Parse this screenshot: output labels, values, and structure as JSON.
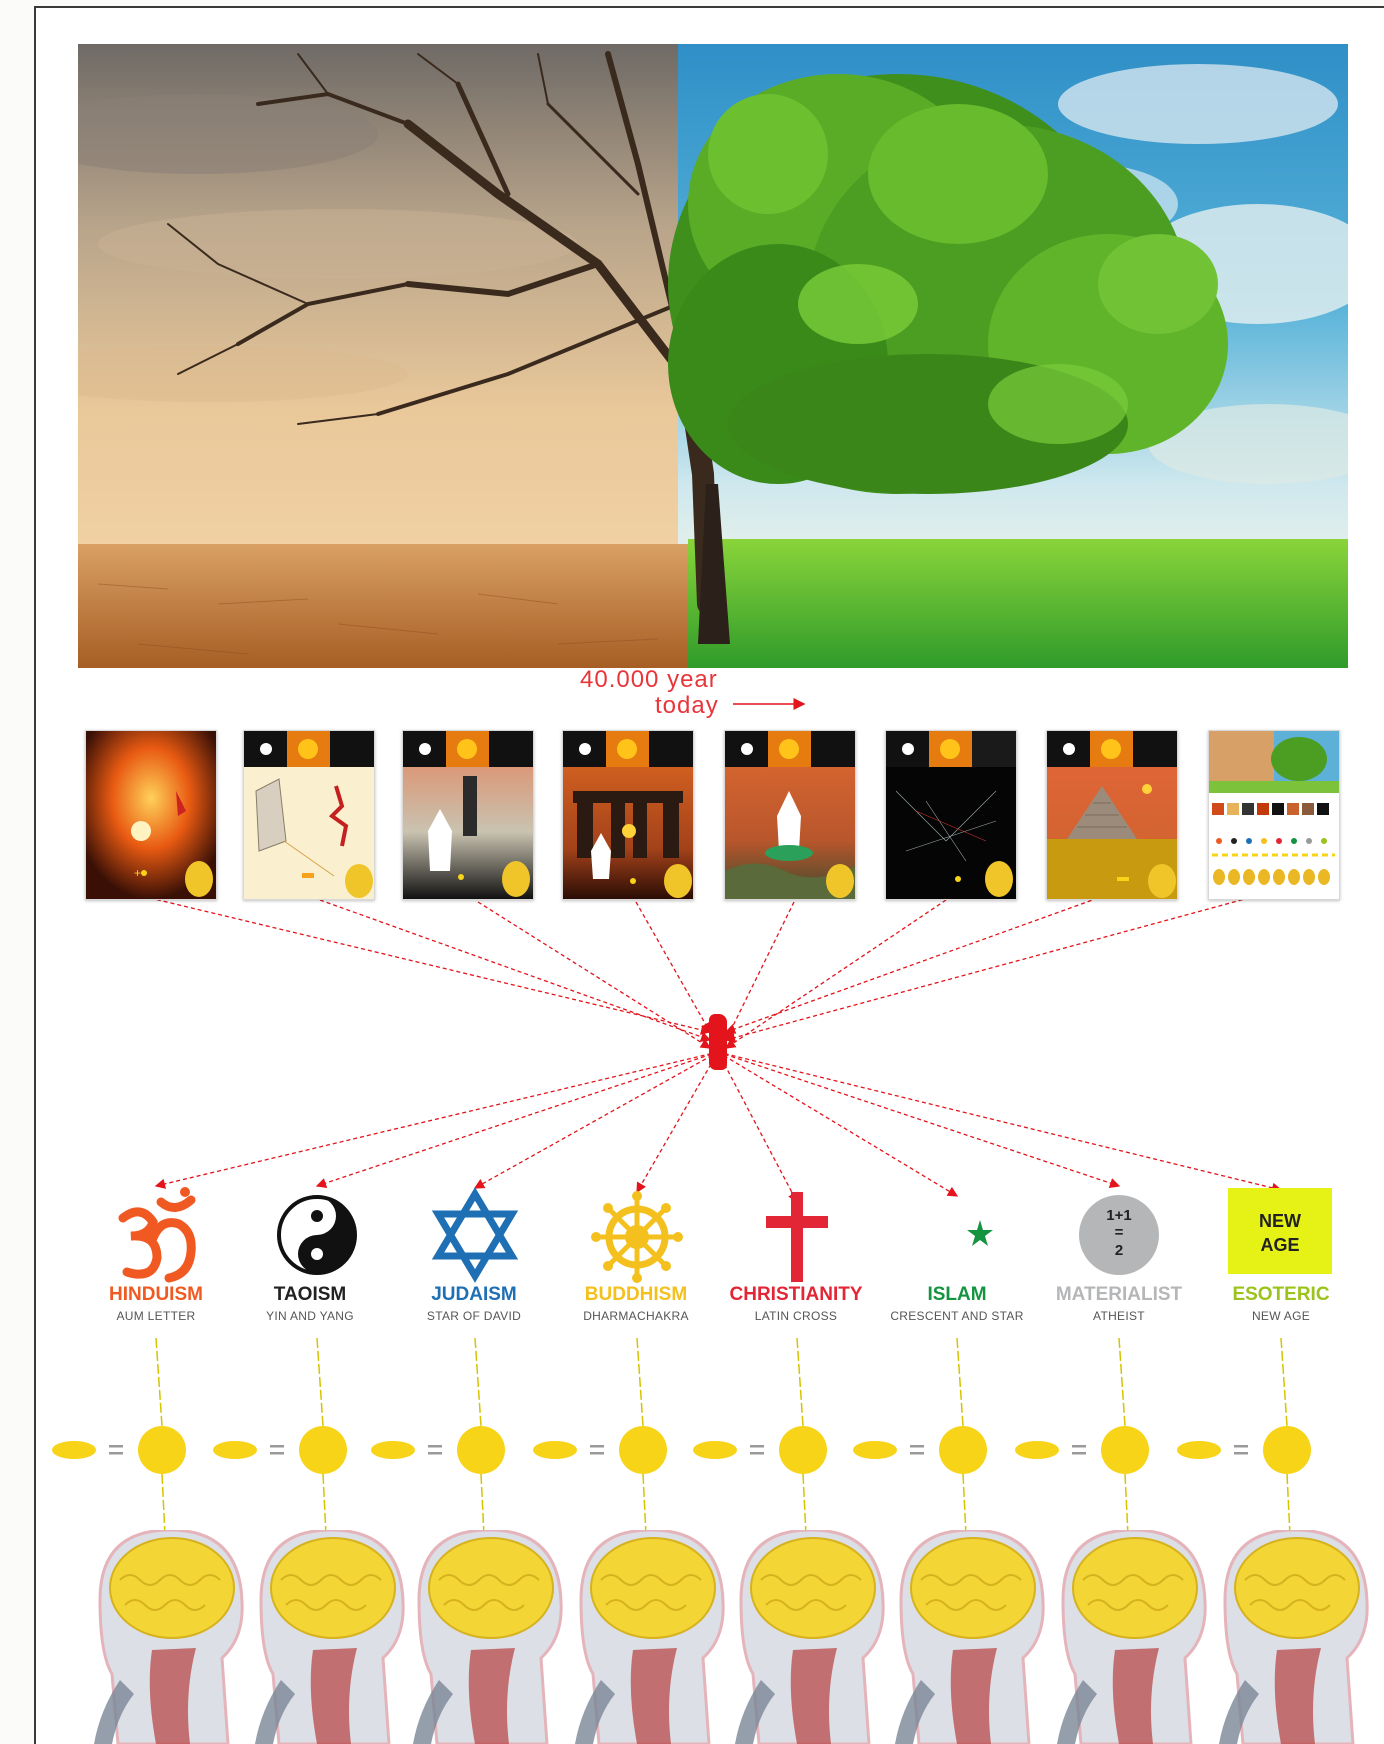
{
  "timeline": {
    "start_label": "40.000 year",
    "end_label": "today"
  },
  "thumbnails": [
    {
      "name": "thumb-cave-fire"
    },
    {
      "name": "thumb-cave-painting"
    },
    {
      "name": "thumb-shaman"
    },
    {
      "name": "thumb-stonehenge"
    },
    {
      "name": "thumb-prophet-water"
    },
    {
      "name": "thumb-dark-lines"
    },
    {
      "name": "thumb-pyramid"
    },
    {
      "name": "thumb-summary"
    }
  ],
  "religions": [
    {
      "name": "HINDUISM",
      "symbol_name": "AUM LETTER",
      "color": "#f05a22",
      "icon": "aum-icon"
    },
    {
      "name": "TAOISM",
      "symbol_name": "YIN AND YANG",
      "color": "#222222",
      "icon": "yin-yang-icon"
    },
    {
      "name": "JUDAISM",
      "symbol_name": "STAR OF DAVID",
      "color": "#1f6fb4",
      "icon": "star-of-david-icon"
    },
    {
      "name": "BUDDHISM",
      "symbol_name": "DHARMACHAKRA",
      "color": "#f4c01e",
      "icon": "dharmachakra-icon"
    },
    {
      "name": "CHRISTIANITY",
      "symbol_name": "LATIN CROSS",
      "color": "#e32636",
      "icon": "latin-cross-icon"
    },
    {
      "name": "ISLAM",
      "symbol_name": "CRESCENT AND STAR",
      "color": "#149440",
      "icon": "crescent-star-icon"
    },
    {
      "name": "MATERIALIST",
      "symbol_name": "ATHEIST",
      "color": "#b5b6b8",
      "icon": "one-plus-one-icon",
      "icon_text": [
        "1+1",
        "=",
        "2"
      ]
    },
    {
      "name": "ESOTERIC",
      "symbol_name": "NEW AGE",
      "color": "#9bc31c",
      "icon": "new-age-icon",
      "icon_text": [
        "NEW",
        "AGE"
      ]
    }
  ],
  "colors": {
    "accent_red": "#e3141c",
    "yellow": "#f7d417",
    "new_age_bg": "#e6f215"
  }
}
